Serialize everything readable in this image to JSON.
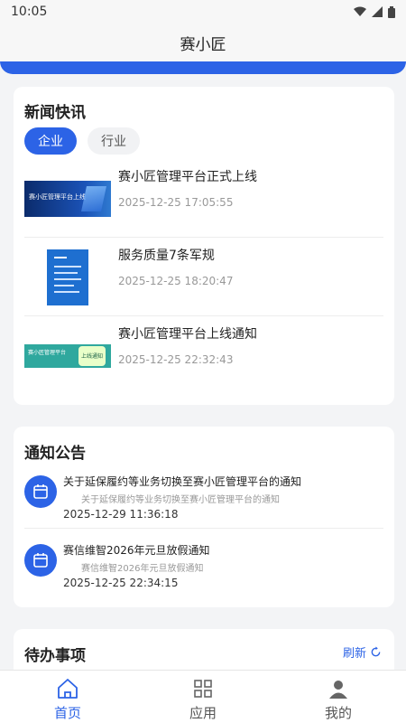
{
  "status_bar": {
    "time": "10:05"
  },
  "header": {
    "title": "赛小匠"
  },
  "news": {
    "title": "新闻快讯",
    "tabs": [
      {
        "label": "企业",
        "active": true
      },
      {
        "label": "行业",
        "active": false
      }
    ],
    "items": [
      {
        "title": "赛小匠管理平台正式上线",
        "date": "2025-12-25 17:05:55",
        "thumb_text": "赛小匠管理平台上线"
      },
      {
        "title": "服务质量7条军规",
        "date": "2025-12-25 18:20:47"
      },
      {
        "title": "赛小匠管理平台上线通知",
        "date": "2025-12-25 22:32:43",
        "thumb_text": "赛小匠管理平台",
        "thumb_badge": "上线通知"
      }
    ]
  },
  "notices": {
    "title": "通知公告",
    "items": [
      {
        "title": "关于延保履约等业务切换至赛小匠管理平台的通知",
        "subtitle": "关于延保履约等业务切换至赛小匠管理平台的通知",
        "date": "2025-12-29 11:36:18"
      },
      {
        "title": "赛信维智2026年元旦放假通知",
        "subtitle": "赛信维智2026年元旦放假通知",
        "date": "2025-12-25 22:34:15"
      }
    ]
  },
  "todo": {
    "title": "待办事项",
    "refresh_label": "刷新"
  },
  "tabbar": {
    "items": [
      {
        "label": "首页",
        "icon": "home-icon",
        "active": true
      },
      {
        "label": "应用",
        "icon": "grid-icon",
        "active": false
      },
      {
        "label": "我的",
        "icon": "user-icon",
        "active": false
      }
    ]
  },
  "colors": {
    "accent": "#2c63e6"
  }
}
